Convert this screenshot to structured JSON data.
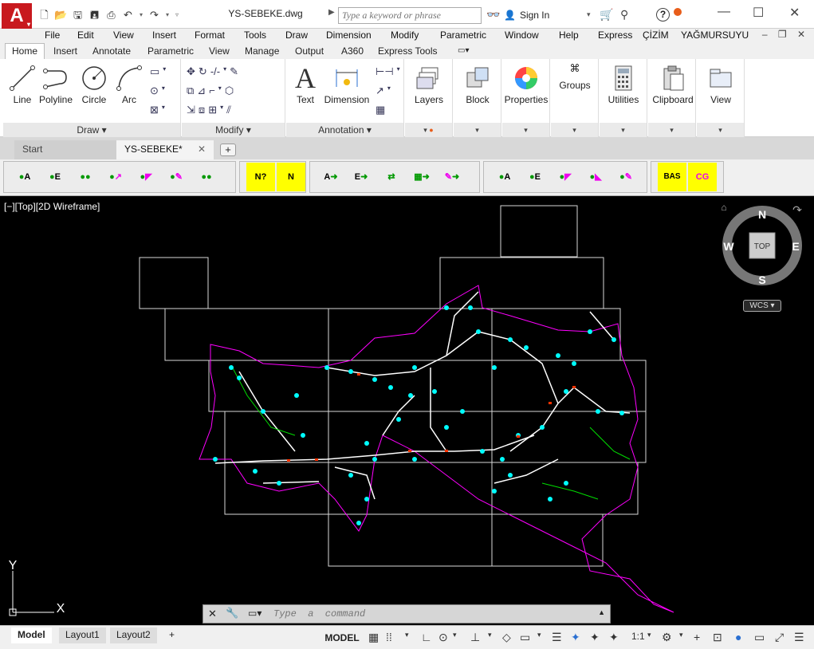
{
  "titlebar": {
    "doc_title": "YS-SEBEKE.dwg",
    "search_placeholder": "Type a keyword or phrase",
    "signin_label": "Sign In"
  },
  "menu": [
    "File",
    "Edit",
    "View",
    "Insert",
    "Format",
    "Tools",
    "Draw",
    "Dimension",
    "Modify",
    "Parametric",
    "Window",
    "Help",
    "Express",
    "ÇİZİM",
    "YAĞMURSUYU"
  ],
  "ribbon_tabs": [
    "Home",
    "Insert",
    "Annotate",
    "Parametric",
    "View",
    "Manage",
    "Output",
    "A360",
    "Express Tools"
  ],
  "ribbon": {
    "draw": {
      "line": "Line",
      "polyline": "Polyline",
      "circle": "Circle",
      "arc": "Arc",
      "panel": "Draw"
    },
    "modify": {
      "panel": "Modify"
    },
    "annotation": {
      "text": "Text",
      "dimension": "Dimension",
      "panel": "Annotation"
    },
    "layers": "Layers",
    "block": "Block",
    "properties": "Properties",
    "groups": "Groups",
    "utilities": "Utilities",
    "clipboard": "Clipboard",
    "view": "View"
  },
  "file_tabs": {
    "start": "Start",
    "doc": "YS-SEBEKE*"
  },
  "custom_toolbar": {
    "group1": [
      "A",
      "E",
      "",
      "",
      "",
      "",
      ""
    ],
    "group2": [
      "N?",
      "N"
    ],
    "group3": [
      "A",
      "E",
      "",
      "",
      ""
    ],
    "group4": [
      "A",
      "E",
      "",
      "",
      ""
    ],
    "group5": [
      "BAS",
      "CG"
    ]
  },
  "viewport": {
    "label": "[−][Top][2D Wireframe]",
    "viewcube": {
      "n": "N",
      "s": "S",
      "e": "E",
      "w": "W",
      "top": "TOP"
    },
    "wcs": "WCS",
    "ucs_x": "X",
    "ucs_y": "Y"
  },
  "command": {
    "placeholder": "Type  a  command"
  },
  "layout_tabs": [
    "Model",
    "Layout1",
    "Layout2"
  ],
  "status": {
    "model": "MODEL",
    "scale": "1:1"
  },
  "colors": {
    "accent": "#c8191e",
    "boundary": "#ff00ff",
    "network": "#ffffff",
    "nodes": "#00ffff",
    "branch": "#00ff00",
    "markers": "#ff3300"
  }
}
